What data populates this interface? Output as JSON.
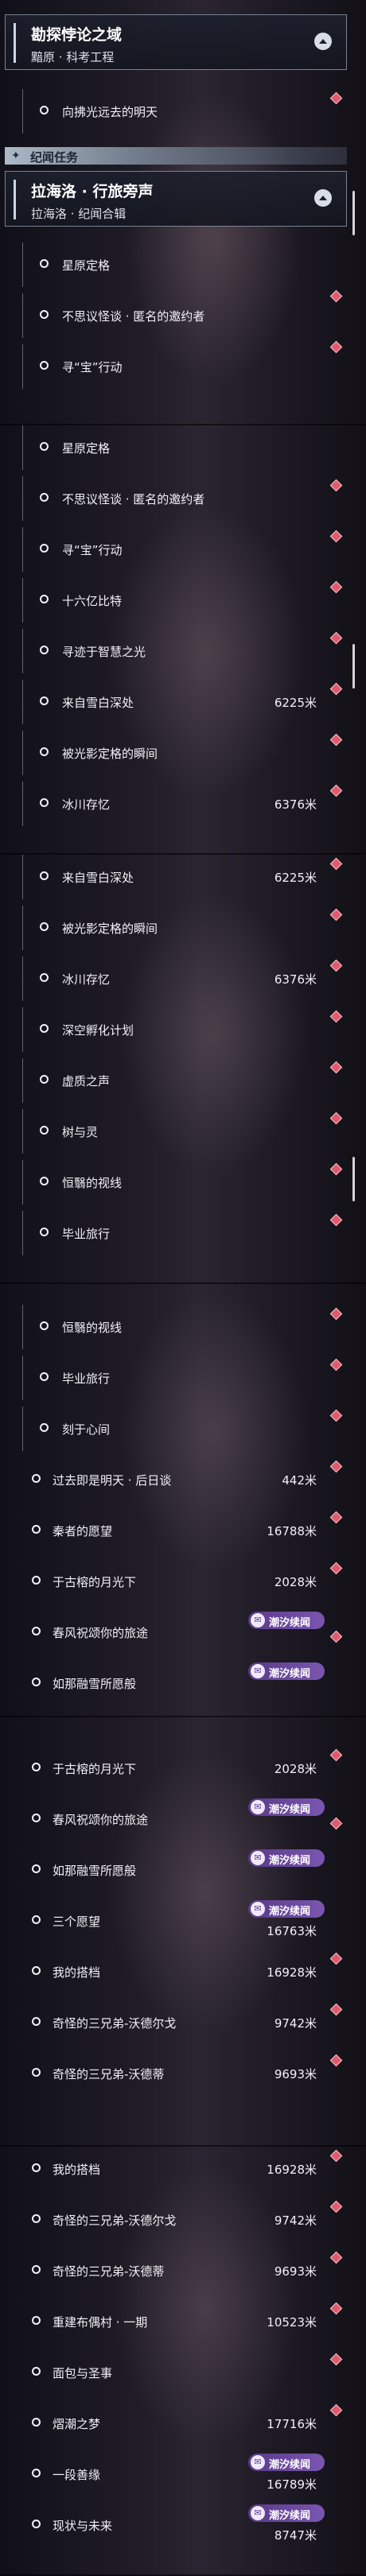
{
  "header_top": {
    "title": "勘探悖论之域",
    "subtitle": "黯原 · 科考工程"
  },
  "section": {
    "label": "纪闻任务",
    "icon": "sparkle-icon"
  },
  "header_quest": {
    "title": "拉海洛 · 行旅旁声",
    "subtitle": "拉海洛 · 纪闻合辑"
  },
  "badge": {
    "label": "潮汐续闻",
    "icon": "tide-icon"
  },
  "colors": {
    "accent": "#e05a6e",
    "badge": "#6a48a0",
    "frame": "#c9d6ea"
  },
  "s1": {
    "prev_quest": "向拂光远去的明天",
    "items": [
      "星原定格",
      "不思议怪谈 · 匿名的邀约者",
      "寻“宝”行动"
    ]
  },
  "s2": {
    "items": [
      "星原定格",
      "不思议怪谈 · 匿名的邀约者",
      "寻“宝”行动",
      "十六亿比特",
      "寻迹于智慧之光",
      "来自雪白深处",
      "被光影定格的瞬间",
      "冰川存忆"
    ],
    "dist": [
      "",
      "",
      "",
      "",
      "",
      "6225米",
      "",
      "6376米"
    ]
  },
  "s3": {
    "items": [
      "来自雪白深处",
      "被光影定格的瞬间",
      "冰川存忆",
      "深空孵化计划",
      "虚质之声",
      "树与灵",
      "恒翳的视线",
      "毕业旅行"
    ],
    "dist": [
      "6225米",
      "",
      "6376米",
      "",
      "",
      "",
      "",
      ""
    ]
  },
  "s4": {
    "items": [
      "恒翳的视线",
      "毕业旅行",
      "刻于心间",
      "过去即是明天 · 后日谈",
      "秦者的愿望",
      "于古榕的月光下",
      "春风祝颂你的旅途",
      "如那融雪所愿般"
    ],
    "dist": [
      "",
      "",
      "",
      "442米",
      "16788米",
      "2028米",
      "",
      ""
    ]
  },
  "s5": {
    "items": [
      "于古榕的月光下",
      "春风祝颂你的旅途",
      "如那融雪所愿般",
      "三个愿望",
      "我的搭档",
      "奇怪的三兄弟-沃德尔戈",
      "奇怪的三兄弟-沃德蒂"
    ],
    "dist": [
      "2028米",
      "",
      "",
      "16763米",
      "16928米",
      "9742米",
      "9693米"
    ]
  },
  "s6": {
    "items": [
      "我的搭档",
      "奇怪的三兄弟-沃德尔戈",
      "奇怪的三兄弟-沃德蒂",
      "重建布偶村 · 一期",
      "面包与圣事",
      "熠潮之梦",
      "一段善缘",
      "现状与未来"
    ],
    "dist": [
      "16928米",
      "9742米",
      "9693米",
      "10523米",
      "",
      "17716米",
      "16789米",
      "8747米"
    ]
  }
}
